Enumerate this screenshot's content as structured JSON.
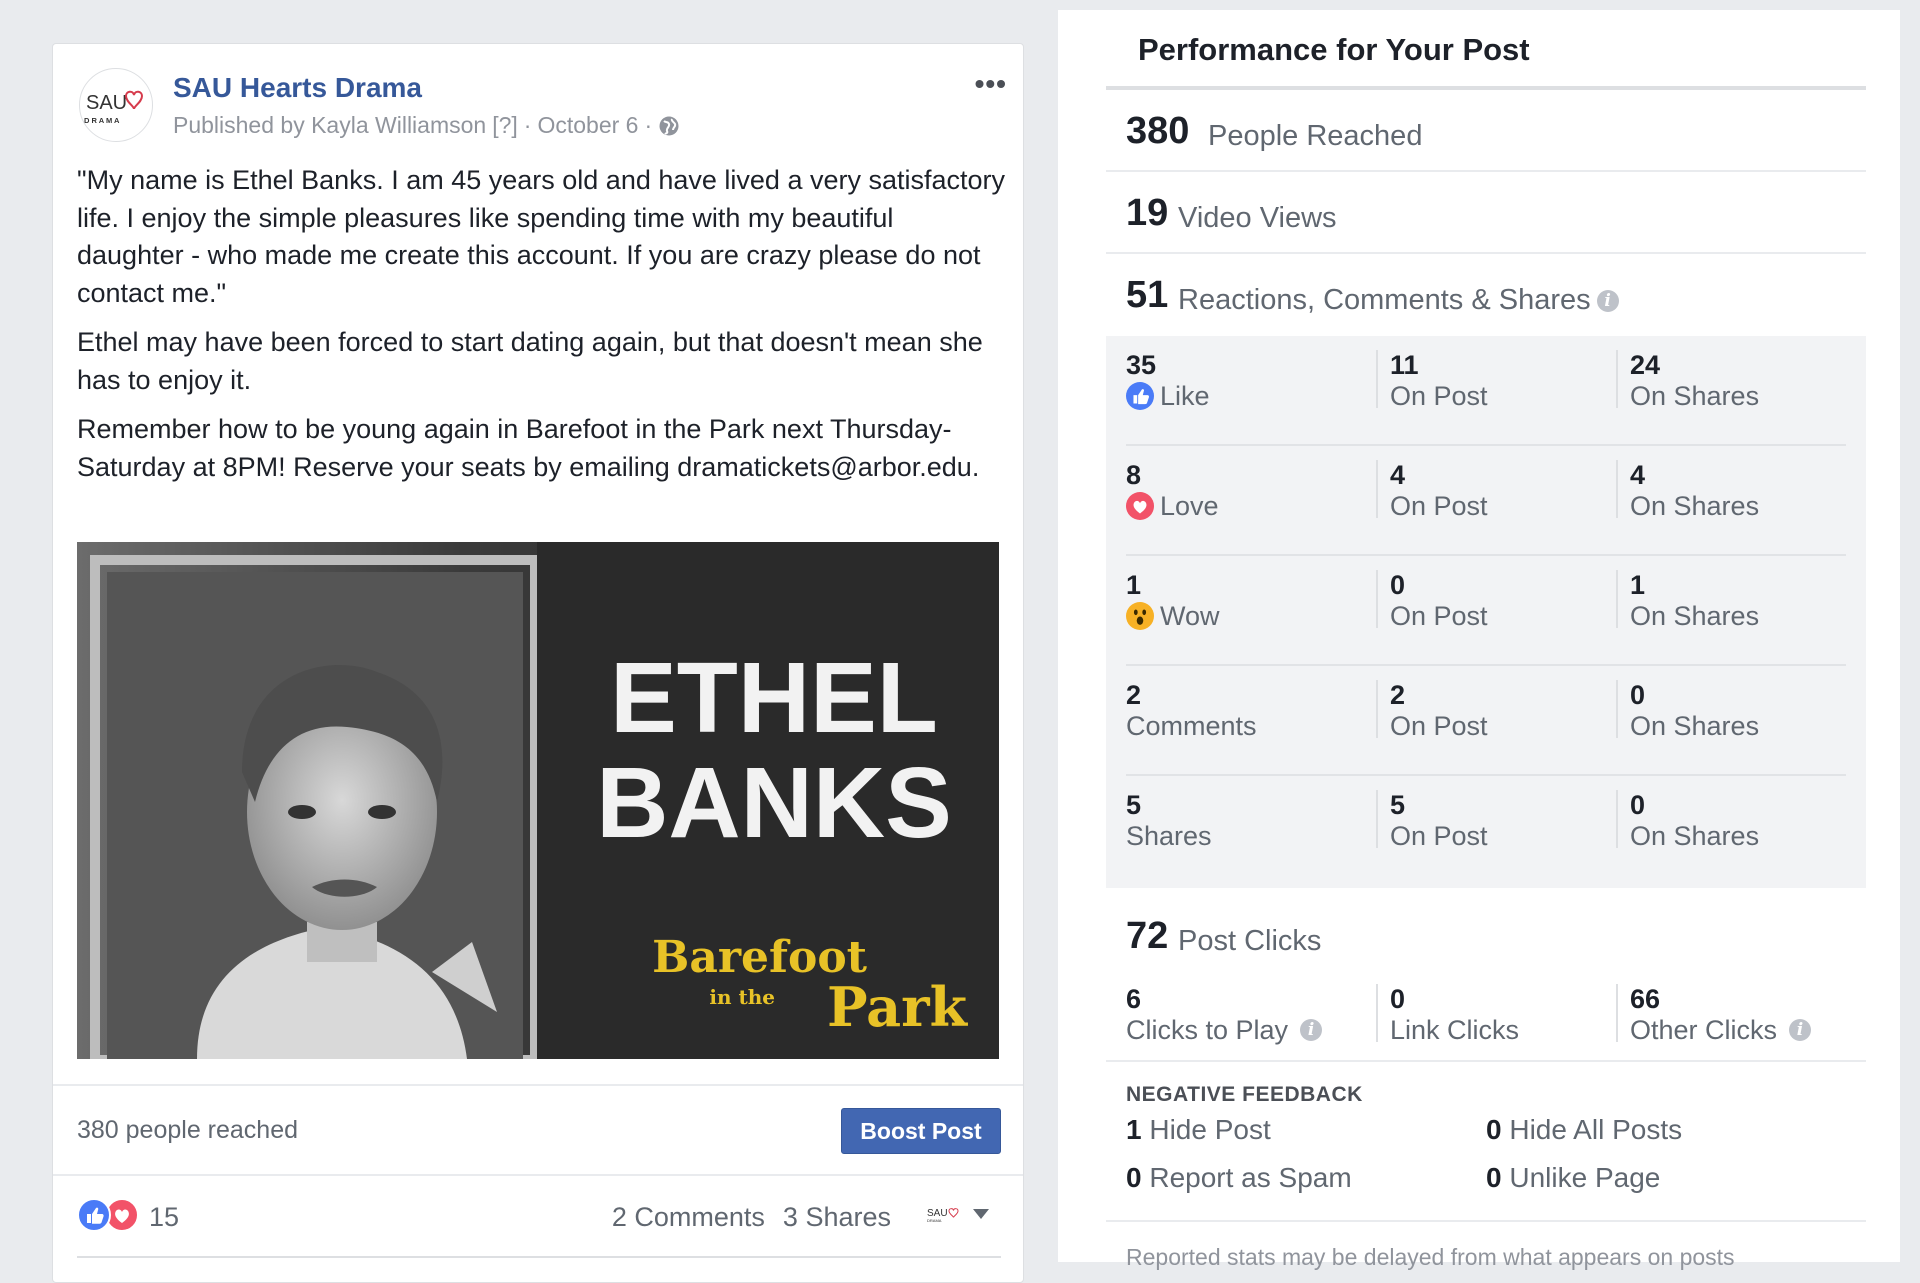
{
  "post": {
    "page_name": "SAU Hearts Drama",
    "avatar": {
      "line1": "SAU",
      "line2": "D R A M A"
    },
    "meta": {
      "published_by": "Published by Kayla Williamson",
      "help": "[?]",
      "date": "October 6"
    },
    "paragraphs": [
      "\"My name is Ethel Banks. I am 45 years old and have lived a very satisfactory life. I enjoy the simple pleasures like spending time with my beautiful daughter - who made me create this account. If you are crazy please do not contact me.\"",
      "Ethel may have been forced to start dating again, but that doesn't mean she has to enjoy it.",
      "Remember how to be young again in Barefoot in the Park next Thursday-Saturday at 8PM! Reserve your seats by emailing dramatickets@arbor.edu."
    ],
    "video": {
      "title_line1": "ETHEL",
      "title_line2": "BANKS",
      "show_line1": "Barefoot",
      "show_in_the": "in the",
      "show_line2": "Park"
    },
    "reach_text": "380 people reached",
    "boost_label": "Boost Post",
    "reaction_count": "15",
    "comments_label": "2 Comments",
    "shares_label": "3 Shares"
  },
  "performance": {
    "title": "Performance for Your Post",
    "people_reached": {
      "num": "380",
      "label": "People Reached"
    },
    "video_views": {
      "num": "19",
      "label": "Video Views"
    },
    "engagement": {
      "num": "51",
      "label": "Reactions, Comments & Shares"
    },
    "breakdown": [
      {
        "total": "35",
        "label": "Like",
        "icon": "like-icon",
        "on_post": "11",
        "on_shares": "24"
      },
      {
        "total": "8",
        "label": "Love",
        "icon": "love-icon",
        "on_post": "4",
        "on_shares": "4"
      },
      {
        "total": "1",
        "label": "Wow",
        "icon": "wow-icon",
        "on_post": "0",
        "on_shares": "1"
      },
      {
        "total": "2",
        "label": "Comments",
        "icon": "",
        "on_post": "2",
        "on_shares": "0"
      },
      {
        "total": "5",
        "label": "Shares",
        "icon": "",
        "on_post": "5",
        "on_shares": "0"
      }
    ],
    "on_post_label": "On Post",
    "on_shares_label": "On Shares",
    "post_clicks": {
      "num": "72",
      "label": "Post Clicks"
    },
    "clicks": [
      {
        "num": "6",
        "label": "Clicks to Play"
      },
      {
        "num": "0",
        "label": "Link Clicks"
      },
      {
        "num": "66",
        "label": "Other Clicks"
      }
    ],
    "negative_title": "NEGATIVE FEEDBACK",
    "negative": [
      {
        "num": "1",
        "label": "Hide Post"
      },
      {
        "num": "0",
        "label": "Hide All Posts"
      },
      {
        "num": "0",
        "label": "Report as Spam"
      },
      {
        "num": "0",
        "label": "Unlike Page"
      }
    ],
    "disclaimer": "Reported stats may be delayed from what appears on posts"
  },
  "colors": {
    "link": "#365899",
    "button": "#4267b2",
    "like": "#4a7bf7",
    "love": "#f25268",
    "wow": "#f7b125"
  }
}
